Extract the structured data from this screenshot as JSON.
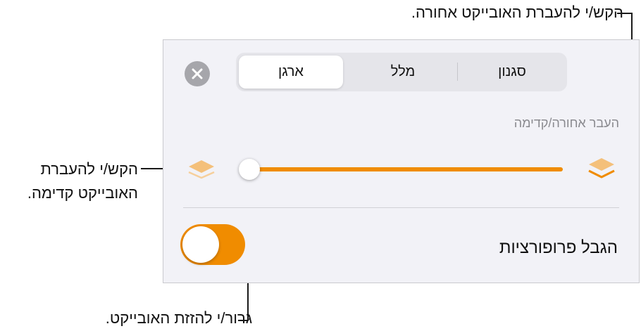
{
  "callouts": {
    "top": "הקש/י להעברת האובייקט אחורה.",
    "left_line1": "הקש/י להעברת",
    "left_line2": "האובייקט קדימה.",
    "bottom": "גרור/י להזזת האובייקט."
  },
  "panel": {
    "tabs": [
      {
        "label": "סגנון",
        "selected": false
      },
      {
        "label": "מלל",
        "selected": false
      },
      {
        "label": "ארגן",
        "selected": true
      }
    ],
    "close_icon": "close-icon",
    "section_label": "העבר אחורה/קדימה",
    "slider": {
      "value": 0,
      "back_icon": "layers-back-icon",
      "front_icon": "layers-front-icon"
    },
    "constrain_label": "הגבל פרופורציות",
    "constrain_toggle_on": true
  },
  "colors": {
    "accent": "#f08c00",
    "panel_bg": "#f2f2f7"
  }
}
